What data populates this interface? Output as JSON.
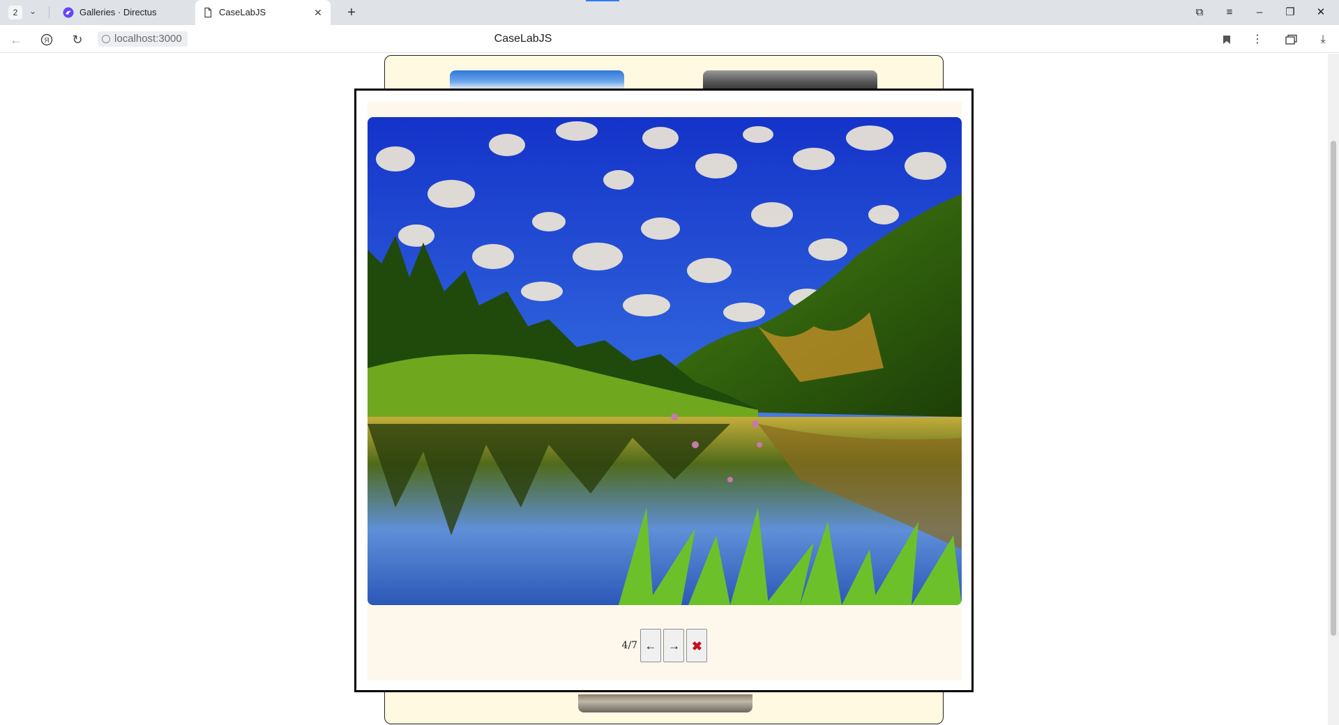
{
  "browser": {
    "tab_count": "2",
    "tabs": [
      {
        "title": "Galleries · Directus",
        "active": false
      },
      {
        "title": "CaseLabJS",
        "active": true
      }
    ],
    "url": "localhost:3000",
    "page_title": "CaseLabJS"
  },
  "icons": {
    "back": "back-arrow-icon",
    "yandex": "yandex-logo-icon",
    "reload": "reload-icon",
    "bookmark": "bookmark-icon",
    "menu": "kebab-menu-icon",
    "collections": "collections-icon",
    "downloads": "download-icon",
    "minimize": "minimize-icon",
    "restore": "restore-icon",
    "close": "close-window-icon"
  },
  "lightbox": {
    "counter": "4/7",
    "prev_label": "←",
    "next_label": "→",
    "close_label": "✖",
    "image": "landscape-lake-forest-photo"
  },
  "colors": {
    "gallery_bg": "#fff9e1",
    "modal_inner_bg": "#fef8ec",
    "close_accent": "#c1121f",
    "tab_bar": "#dfe3e8"
  }
}
